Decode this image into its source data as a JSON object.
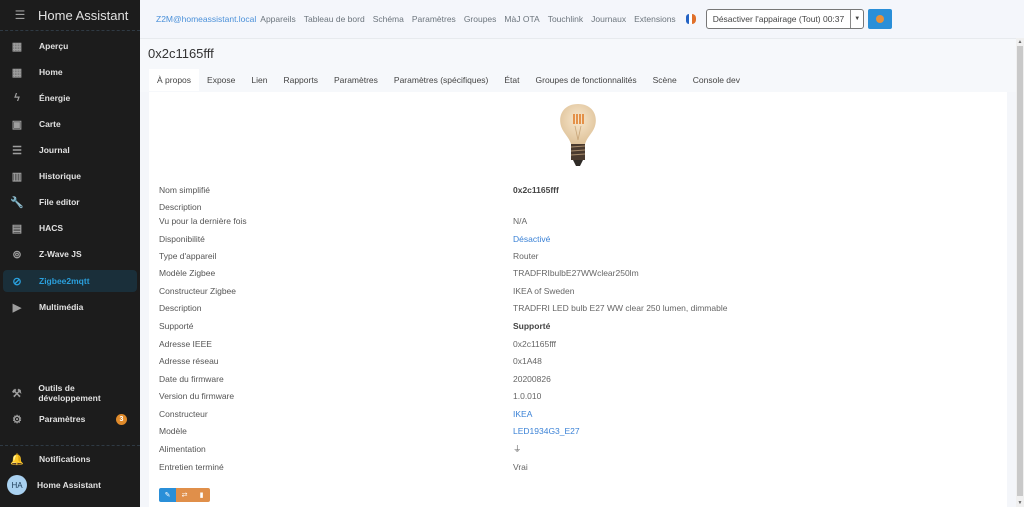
{
  "sidebar": {
    "title": "Home Assistant",
    "items": [
      {
        "label": "Aperçu",
        "icon": "dashboard-icon",
        "glyph": "▦"
      },
      {
        "label": "Home",
        "icon": "dashboard-icon",
        "glyph": "▦"
      },
      {
        "label": "Énergie",
        "icon": "lightning-icon",
        "glyph": "ϟ"
      },
      {
        "label": "Carte",
        "icon": "map-icon",
        "glyph": "▣"
      },
      {
        "label": "Journal",
        "icon": "list-icon",
        "glyph": "☰"
      },
      {
        "label": "Historique",
        "icon": "chart-icon",
        "glyph": "▥"
      },
      {
        "label": "File editor",
        "icon": "wrench-icon",
        "glyph": "🔧"
      },
      {
        "label": "HACS",
        "icon": "hacs-icon",
        "glyph": "▤"
      },
      {
        "label": "Z-Wave JS",
        "icon": "zwave-icon",
        "glyph": "⊚"
      },
      {
        "label": "Zigbee2mqtt",
        "icon": "zigbee-icon",
        "glyph": "⊘",
        "active": true
      },
      {
        "label": "Multimédia",
        "icon": "media-icon",
        "glyph": "▶"
      }
    ],
    "bottom": [
      {
        "label": "Outils de développement",
        "icon": "hammer-icon",
        "glyph": "⚒"
      },
      {
        "label": "Paramètres",
        "icon": "gear-icon",
        "glyph": "⚙",
        "badge": "3"
      }
    ],
    "notifications_label": "Notifications",
    "user": {
      "initials": "HA",
      "name": "Home Assistant"
    }
  },
  "topnav": {
    "brand": "Z2M@homeassistant.local",
    "links": [
      "Appareils",
      "Tableau de bord",
      "Schéma",
      "Paramètres",
      "Groupes",
      "MàJ OTA",
      "Touchlink",
      "Journaux",
      "Extensions"
    ],
    "language_flag": "fr",
    "permit_join_label": "Désactiver l'appairage (Tout) 00:37",
    "flag_colors": [
      "#2463c4",
      "#ffffff",
      "#e0702a"
    ]
  },
  "device": {
    "title": "0x2c1165fff",
    "tabs": [
      "À propos",
      "Expose",
      "Lien",
      "Rapports",
      "Paramètres",
      "Paramètres (spécifiques)",
      "État",
      "Groupes de fonctionnalités",
      "Scène",
      "Console dev"
    ],
    "active_tab": "À propos",
    "image_alt": "light-bulb",
    "properties": [
      {
        "key": "Nom simplifié",
        "value": "0x2c1165fff",
        "style": "bold"
      },
      {
        "key": "Description",
        "value": ""
      },
      {
        "key": "Vu pour la dernière fois",
        "value": "N/A"
      },
      {
        "key": "Disponibilité",
        "value": "Désactivé",
        "style": "link"
      },
      {
        "key": "Type d'appareil",
        "value": "Router"
      },
      {
        "key": "Modèle Zigbee",
        "value": "TRADFRIbulbE27WWclear250lm"
      },
      {
        "key": "Constructeur Zigbee",
        "value": "IKEA of Sweden"
      },
      {
        "key": "Description",
        "value": "TRADFRI LED bulb E27 WW clear 250 lumen, dimmable"
      },
      {
        "key": "Supporté",
        "value": "Supporté",
        "style": "bold"
      },
      {
        "key": "Adresse IEEE",
        "value": "0x2c1165fff"
      },
      {
        "key": "Adresse réseau",
        "value": "0x1A48"
      },
      {
        "key": "Date du firmware",
        "value": "20200826"
      },
      {
        "key": "Version du firmware",
        "value": "1.0.010"
      },
      {
        "key": "Constructeur",
        "value": "IKEA",
        "style": "link"
      },
      {
        "key": "Modèle",
        "value": "LED1934G3_E27",
        "style": "link"
      },
      {
        "key": "Alimentation",
        "value": "⏚",
        "style": "icon",
        "icon": "plug-icon"
      },
      {
        "key": "Entretien terminé",
        "value": "Vrai"
      }
    ],
    "actions": [
      {
        "name": "edit-button",
        "glyph": "✎"
      },
      {
        "name": "rename-button",
        "glyph": "⇄"
      },
      {
        "name": "delete-button",
        "glyph": "🗑"
      }
    ]
  },
  "colors": {
    "accent": "#2a8fd8",
    "warning": "#e08f4a",
    "link": "#3b82d6",
    "sidebar_bg": "#1c1c1c"
  }
}
